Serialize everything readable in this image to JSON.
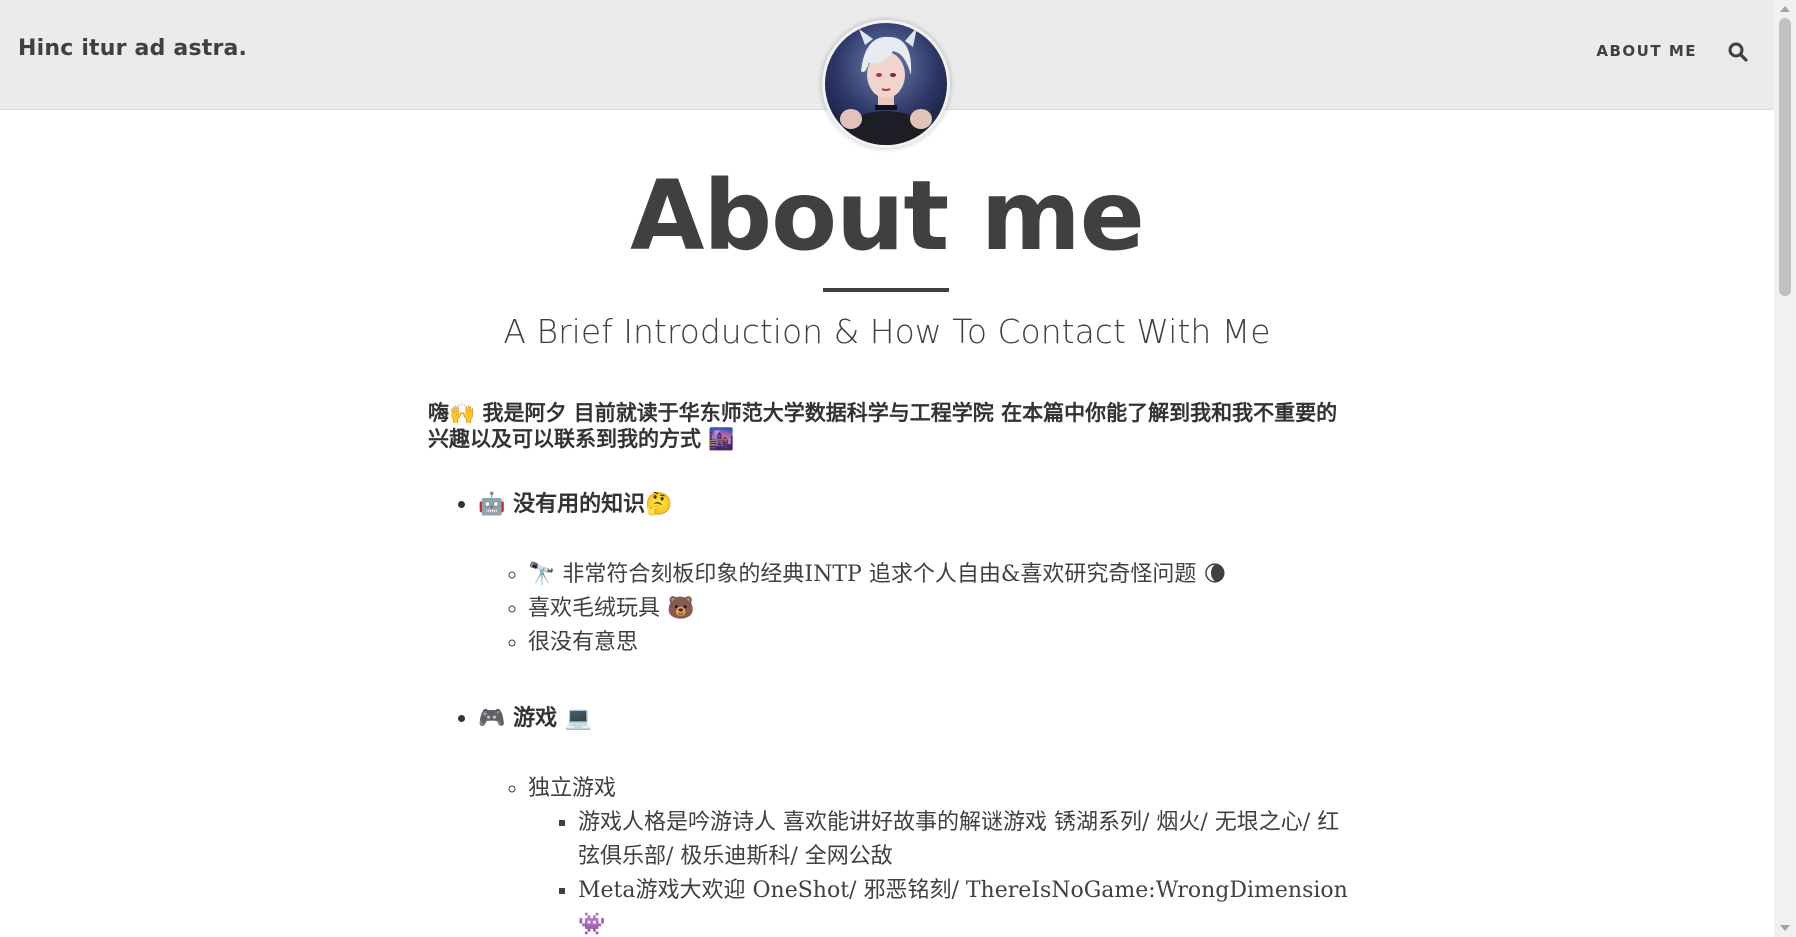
{
  "navbar": {
    "brand": "Hinc itur ad astra.",
    "about_label": "ABOUT ME",
    "search_icon": "search-icon"
  },
  "header": {
    "title": "About me",
    "subtitle": "A Brief Introduction & How To Contact With Me"
  },
  "content": {
    "intro": "嗨🙌 我是阿夕 目前就读于华东师范大学数据科学与工程学院 在本篇中你能了解到我和我不重要的兴趣以及可以联系到我的方式 🌆",
    "sections": [
      {
        "icon": "🤖",
        "label": "没有用的知识",
        "icon_after": "🤔",
        "items": [
          {
            "icon": "🔭",
            "text": "非常符合刻板印象的经典INTP 追求个人自由&喜欢研究奇怪问题",
            "icon_after": "🌘"
          },
          {
            "text": "喜欢毛绒玩具",
            "icon_after": "🐻"
          },
          {
            "text": "很没有意思"
          }
        ]
      },
      {
        "icon": "🎮",
        "label": "游戏",
        "icon_after": "💻",
        "items": [
          {
            "text": "独立游戏",
            "subitems": [
              {
                "text": "游戏人格是吟游诗人 喜欢能讲好故事的解谜游戏 锈湖系列/ 烟火/ 无垠之心/ 红弦俱乐部/ 极乐迪斯科/ 全网公敌"
              },
              {
                "text": "Meta游戏大欢迎 OneShot/ 邪恶铭刻/ ThereIsNoGame:WrongDimension",
                "icon_after": "👾"
              }
            ]
          }
        ]
      }
    ]
  },
  "colors": {
    "navbar_bg": "#ebebeb",
    "text": "#404040"
  }
}
